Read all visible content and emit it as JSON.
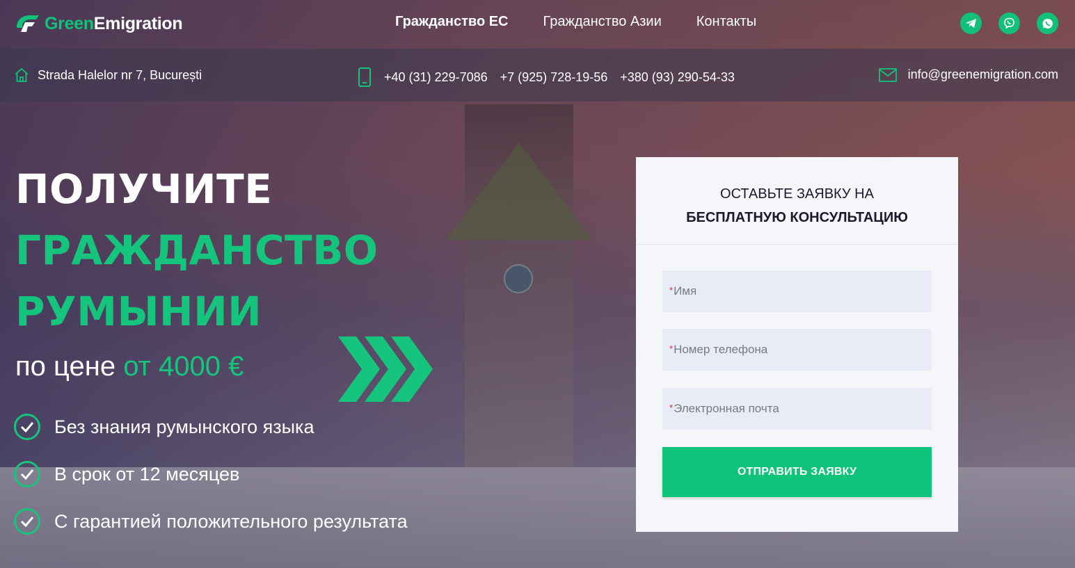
{
  "brand": {
    "name_part1": "Green",
    "name_part2": "Emigration",
    "accent_color": "#11c27a"
  },
  "nav": {
    "items": [
      {
        "label": "Гражданство ЕС",
        "active": true
      },
      {
        "label": "Гражданство Азии",
        "active": false
      },
      {
        "label": "Контакты",
        "active": false
      }
    ]
  },
  "social": [
    {
      "icon": "telegram-icon"
    },
    {
      "icon": "viber-icon"
    },
    {
      "icon": "whatsapp-icon"
    }
  ],
  "contacts": {
    "address": "Strada Halelor nr 7, București",
    "phones": [
      "+40 (31) 229-7086",
      "+7 (925) 728-19-56",
      "+380 (93) 290-54-33"
    ],
    "email": "info@greenemigration.com"
  },
  "hero": {
    "line1": "ПОЛУЧИТЕ",
    "line2": "ГРАЖДАНСТВО",
    "line3": "РУМЫНИИ",
    "price_prefix": "по цене",
    "price_value": "от 4000 €",
    "features": [
      "Без знания румынского языка",
      "В срок от 12 месяцев",
      "С гарантией положительного результата"
    ]
  },
  "form": {
    "title_line1": "ОСТАВЬТЕ ЗАЯВКУ НА",
    "title_line2": "БЕСПЛАТНУЮ КОНСУЛЬТАЦИЮ",
    "required_mark": "*",
    "fields": [
      {
        "placeholder": "Имя"
      },
      {
        "placeholder": "Номер телефона"
      },
      {
        "placeholder": "Электронная почта"
      }
    ],
    "submit_label": "ОТПРАВИТЬ ЗАЯВКУ"
  }
}
